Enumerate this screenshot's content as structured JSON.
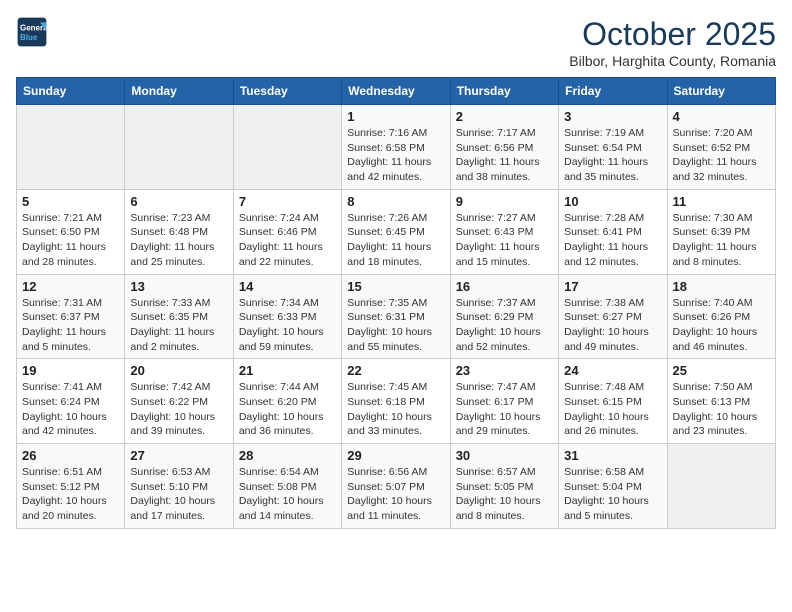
{
  "logo": {
    "line1": "General",
    "line2": "Blue"
  },
  "header": {
    "month": "October 2025",
    "location": "Bilbor, Harghita County, Romania"
  },
  "weekdays": [
    "Sunday",
    "Monday",
    "Tuesday",
    "Wednesday",
    "Thursday",
    "Friday",
    "Saturday"
  ],
  "weeks": [
    [
      {
        "day": "",
        "info": ""
      },
      {
        "day": "",
        "info": ""
      },
      {
        "day": "",
        "info": ""
      },
      {
        "day": "1",
        "info": "Sunrise: 7:16 AM\nSunset: 6:58 PM\nDaylight: 11 hours and 42 minutes."
      },
      {
        "day": "2",
        "info": "Sunrise: 7:17 AM\nSunset: 6:56 PM\nDaylight: 11 hours and 38 minutes."
      },
      {
        "day": "3",
        "info": "Sunrise: 7:19 AM\nSunset: 6:54 PM\nDaylight: 11 hours and 35 minutes."
      },
      {
        "day": "4",
        "info": "Sunrise: 7:20 AM\nSunset: 6:52 PM\nDaylight: 11 hours and 32 minutes."
      }
    ],
    [
      {
        "day": "5",
        "info": "Sunrise: 7:21 AM\nSunset: 6:50 PM\nDaylight: 11 hours and 28 minutes."
      },
      {
        "day": "6",
        "info": "Sunrise: 7:23 AM\nSunset: 6:48 PM\nDaylight: 11 hours and 25 minutes."
      },
      {
        "day": "7",
        "info": "Sunrise: 7:24 AM\nSunset: 6:46 PM\nDaylight: 11 hours and 22 minutes."
      },
      {
        "day": "8",
        "info": "Sunrise: 7:26 AM\nSunset: 6:45 PM\nDaylight: 11 hours and 18 minutes."
      },
      {
        "day": "9",
        "info": "Sunrise: 7:27 AM\nSunset: 6:43 PM\nDaylight: 11 hours and 15 minutes."
      },
      {
        "day": "10",
        "info": "Sunrise: 7:28 AM\nSunset: 6:41 PM\nDaylight: 11 hours and 12 minutes."
      },
      {
        "day": "11",
        "info": "Sunrise: 7:30 AM\nSunset: 6:39 PM\nDaylight: 11 hours and 8 minutes."
      }
    ],
    [
      {
        "day": "12",
        "info": "Sunrise: 7:31 AM\nSunset: 6:37 PM\nDaylight: 11 hours and 5 minutes."
      },
      {
        "day": "13",
        "info": "Sunrise: 7:33 AM\nSunset: 6:35 PM\nDaylight: 11 hours and 2 minutes."
      },
      {
        "day": "14",
        "info": "Sunrise: 7:34 AM\nSunset: 6:33 PM\nDaylight: 10 hours and 59 minutes."
      },
      {
        "day": "15",
        "info": "Sunrise: 7:35 AM\nSunset: 6:31 PM\nDaylight: 10 hours and 55 minutes."
      },
      {
        "day": "16",
        "info": "Sunrise: 7:37 AM\nSunset: 6:29 PM\nDaylight: 10 hours and 52 minutes."
      },
      {
        "day": "17",
        "info": "Sunrise: 7:38 AM\nSunset: 6:27 PM\nDaylight: 10 hours and 49 minutes."
      },
      {
        "day": "18",
        "info": "Sunrise: 7:40 AM\nSunset: 6:26 PM\nDaylight: 10 hours and 46 minutes."
      }
    ],
    [
      {
        "day": "19",
        "info": "Sunrise: 7:41 AM\nSunset: 6:24 PM\nDaylight: 10 hours and 42 minutes."
      },
      {
        "day": "20",
        "info": "Sunrise: 7:42 AM\nSunset: 6:22 PM\nDaylight: 10 hours and 39 minutes."
      },
      {
        "day": "21",
        "info": "Sunrise: 7:44 AM\nSunset: 6:20 PM\nDaylight: 10 hours and 36 minutes."
      },
      {
        "day": "22",
        "info": "Sunrise: 7:45 AM\nSunset: 6:18 PM\nDaylight: 10 hours and 33 minutes."
      },
      {
        "day": "23",
        "info": "Sunrise: 7:47 AM\nSunset: 6:17 PM\nDaylight: 10 hours and 29 minutes."
      },
      {
        "day": "24",
        "info": "Sunrise: 7:48 AM\nSunset: 6:15 PM\nDaylight: 10 hours and 26 minutes."
      },
      {
        "day": "25",
        "info": "Sunrise: 7:50 AM\nSunset: 6:13 PM\nDaylight: 10 hours and 23 minutes."
      }
    ],
    [
      {
        "day": "26",
        "info": "Sunrise: 6:51 AM\nSunset: 5:12 PM\nDaylight: 10 hours and 20 minutes."
      },
      {
        "day": "27",
        "info": "Sunrise: 6:53 AM\nSunset: 5:10 PM\nDaylight: 10 hours and 17 minutes."
      },
      {
        "day": "28",
        "info": "Sunrise: 6:54 AM\nSunset: 5:08 PM\nDaylight: 10 hours and 14 minutes."
      },
      {
        "day": "29",
        "info": "Sunrise: 6:56 AM\nSunset: 5:07 PM\nDaylight: 10 hours and 11 minutes."
      },
      {
        "day": "30",
        "info": "Sunrise: 6:57 AM\nSunset: 5:05 PM\nDaylight: 10 hours and 8 minutes."
      },
      {
        "day": "31",
        "info": "Sunrise: 6:58 AM\nSunset: 5:04 PM\nDaylight: 10 hours and 5 minutes."
      },
      {
        "day": "",
        "info": ""
      }
    ]
  ]
}
